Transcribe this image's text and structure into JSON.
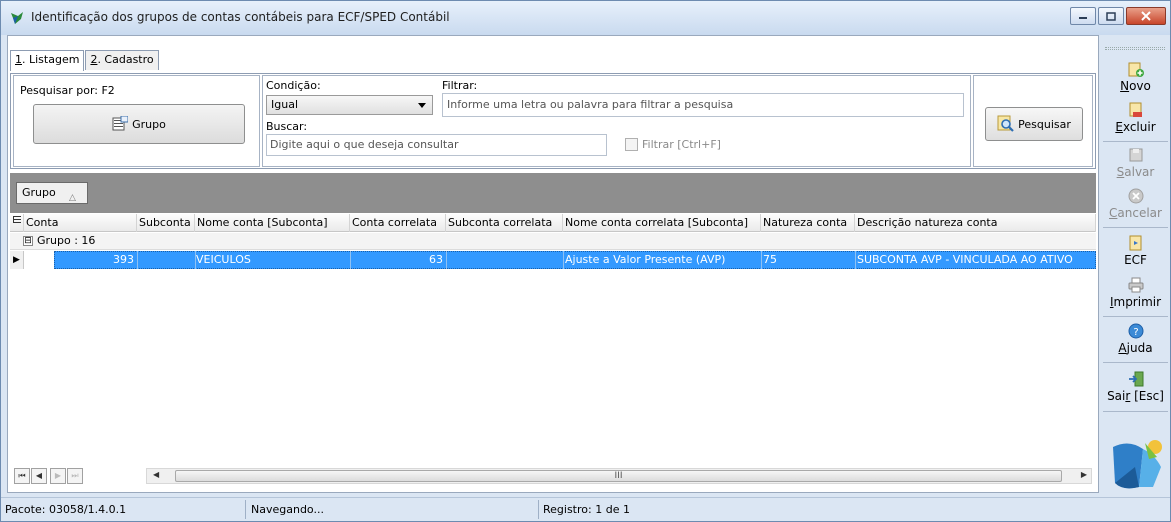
{
  "window": {
    "title": "Identificação dos grupos de contas contábeis para ECF/SPED Contábil"
  },
  "tabs": [
    {
      "key": "1",
      "label": ". Listagem"
    },
    {
      "key": "2",
      "label": ". Cadastro"
    }
  ],
  "search": {
    "search_by_label": "Pesquisar por: F2",
    "group_button_label": "Grupo",
    "condition_label": "Condição:",
    "condition_value": "Igual",
    "filter_label": "Filtrar:",
    "filter_placeholder": "Informe uma letra ou palavra para filtrar a pesquisa",
    "search_label": "Buscar:",
    "search_placeholder": "Digite aqui o que deseja consultar",
    "filter_checkbox_label": "Filtrar [Ctrl+F]",
    "search_button_label": "Pesquisar"
  },
  "grouping": {
    "chip_label": "Grupo",
    "chip_sort_glyph": "△"
  },
  "grid": {
    "columns": [
      "Conta",
      "Subconta",
      "Nome conta [Subconta]",
      "Conta correlata",
      "Subconta correlata",
      "Nome conta correlata [Subconta]",
      "Natureza conta",
      "Descrição natureza conta"
    ],
    "group_row": "Grupo : 16",
    "group_toggle": "⊟",
    "row_indicator": "▶",
    "rows": [
      {
        "conta": "393",
        "subconta": "",
        "nome_conta": "VEICULOS",
        "conta_correlata": "63",
        "subconta_correlata": "",
        "nome_conta_correlata": "Ajuste a Valor Presente (AVP)",
        "natureza": "75",
        "descricao_natureza": "SUBCONTA AVP - VINCULADA AO ATIVO"
      }
    ]
  },
  "navigator": {
    "first": "⏮",
    "prev": "◀",
    "next": "▶",
    "last": "⏭",
    "scroll_left": "◀",
    "scroll_right": "▶",
    "thumb_grip": "III"
  },
  "toolbar": {
    "novo": "ovo",
    "novo_underline": "N",
    "excluir": "xcluir",
    "excluir_underline": "E",
    "salvar": "alvar",
    "salvar_underline": "S",
    "cancelar": "ancelar",
    "cancelar_underline": "C",
    "ecf": "ECF",
    "imprimir": "mprimir",
    "imprimir_underline": "I",
    "ajuda": "juda",
    "ajuda_underline": "A",
    "sair_pre": "Sai",
    "sair_underline": "r",
    "sair_post": " [Esc]"
  },
  "status": {
    "package": "Pacote: 03058/1.4.0.1",
    "state": "Navegando...",
    "record": "Registro: 1 de 1"
  },
  "colors": {
    "selection": "#3399ff",
    "group_band": "#8e8e8e",
    "frame": "#dbe6f3"
  }
}
